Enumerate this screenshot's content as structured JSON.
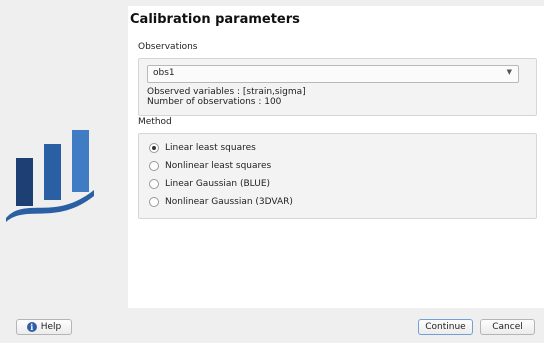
{
  "page": {
    "title": "Calibration parameters"
  },
  "observations": {
    "section_label": "Observations",
    "selected": "obs1",
    "observed_variables": "Observed variables : [strain,sigma]",
    "num_observations": "Number of observations : 100"
  },
  "method": {
    "section_label": "Method",
    "options": [
      {
        "label": "Linear least squares",
        "checked": true
      },
      {
        "label": "Nonlinear least squares",
        "checked": false
      },
      {
        "label": "Linear Gaussian (BLUE)",
        "checked": false
      },
      {
        "label": "Nonlinear Gaussian (3DVAR)",
        "checked": false
      }
    ]
  },
  "buttons": {
    "help": "Help",
    "continue": "Continue",
    "cancel": "Cancel"
  },
  "colors": {
    "logo_blue": "#2a5fa3",
    "logo_dark": "#1e3f73",
    "accent": "#6fa0d8"
  }
}
